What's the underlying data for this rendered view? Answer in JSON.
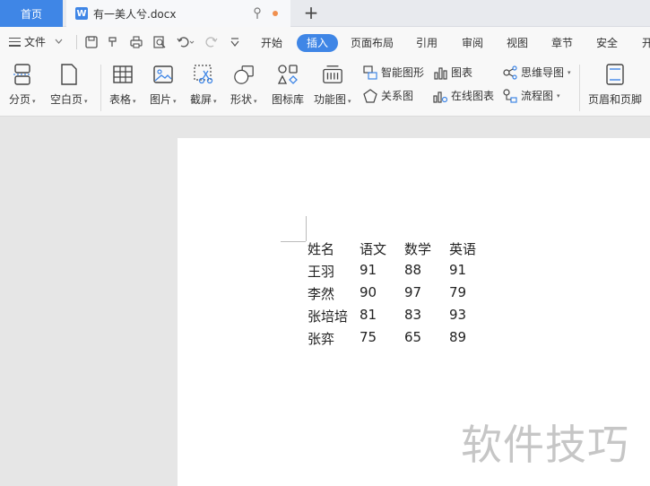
{
  "tabs": {
    "home_label": "首页",
    "doc_icon_letter": "W",
    "doc_label": "有一美人兮.docx",
    "add_symbol": "+"
  },
  "menu": {
    "file_label": "文件",
    "tabs": [
      "开始",
      "插入",
      "页面布局",
      "引用",
      "审阅",
      "视图",
      "章节",
      "安全",
      "开"
    ],
    "active_tab": "插入"
  },
  "ribbon": {
    "page_break": "分页",
    "blank_page": "空白页",
    "table": "表格",
    "picture": "图片",
    "screenshot": "截屏",
    "shape": "形状",
    "icon_library": "图标库",
    "function_chart": "功能图",
    "smart_art": "智能图形",
    "chart": "图表",
    "mind_map": "思维导图",
    "relation_chart": "关系图",
    "online_chart": "在线图表",
    "flow_chart": "流程图",
    "header_footer": "页眉和页脚"
  },
  "document": {
    "header": [
      "姓名",
      "语文",
      "数学",
      "英语"
    ],
    "rows": [
      [
        "王羽",
        "91",
        "88",
        "91"
      ],
      [
        "李然",
        "90",
        "97",
        "79"
      ],
      [
        "张培培",
        "81",
        "83",
        "93"
      ],
      [
        "张弈",
        "75",
        "65",
        "89"
      ]
    ]
  },
  "watermark": "软件技巧",
  "colors": {
    "accent": "#3f86e6",
    "modified_dot": "#f0904f"
  }
}
